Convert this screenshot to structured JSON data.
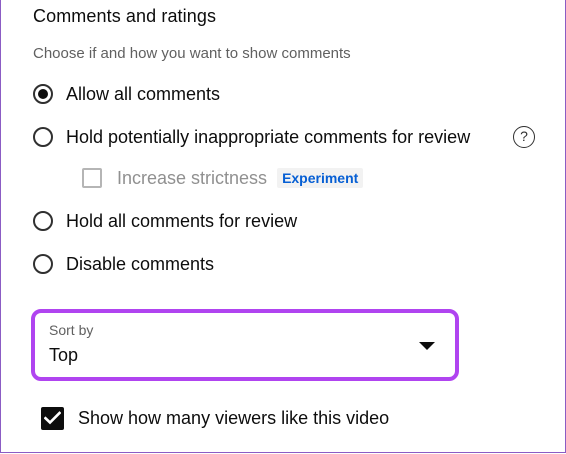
{
  "section": {
    "title": "Comments and ratings",
    "description": "Choose if and how you want to show comments"
  },
  "comment_options": [
    {
      "label": "Allow all comments",
      "selected": true
    },
    {
      "label": "Hold potentially inappropriate comments for review",
      "selected": false
    },
    {
      "label": "Hold all comments for review",
      "selected": false
    },
    {
      "label": "Disable comments",
      "selected": false
    }
  ],
  "strictness": {
    "label": "Increase strictness",
    "badge": "Experiment",
    "checked": false,
    "enabled": false
  },
  "help_icon": {
    "icon": "help-circle-icon",
    "glyph": "?"
  },
  "sort": {
    "label": "Sort by",
    "value": "Top",
    "icon": "caret-down-icon",
    "highlight_color": "#b044f0"
  },
  "show_likes": {
    "label": "Show how many viewers like this video",
    "checked": true
  },
  "colors": {
    "text": "#0d0d0d",
    "secondary_text": "#606060",
    "badge_text": "#065fd4",
    "frame": "#8b5cc4"
  }
}
